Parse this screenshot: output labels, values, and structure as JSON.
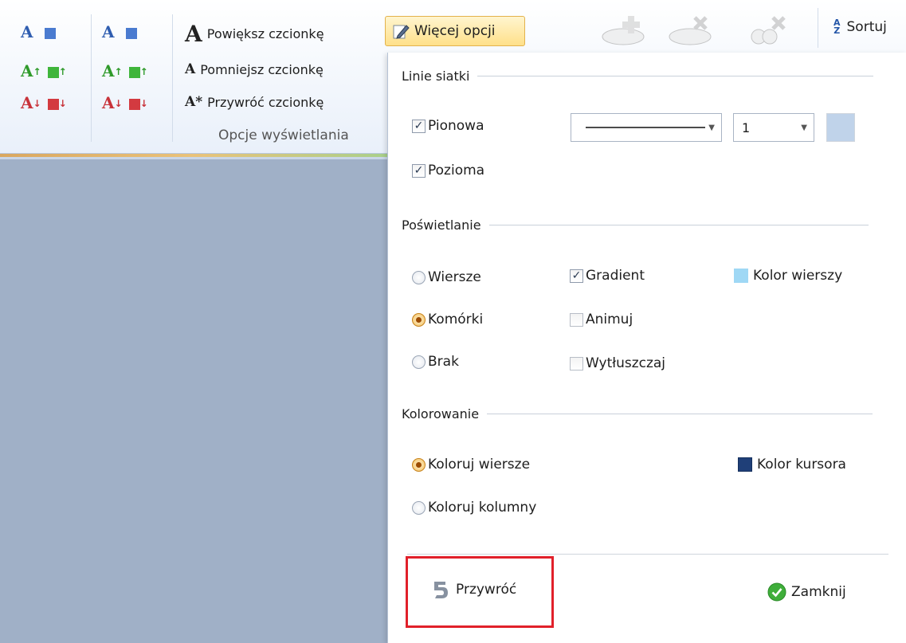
{
  "ribbon": {
    "font_glyph": "A",
    "arrow_up": "↑",
    "arrow_down": "↓",
    "commands": {
      "enlarge": "Powiększ czcionkę",
      "shrink": "Pomniejsz czcionkę",
      "restore": "Przywróć czcionkę",
      "restore_glyph": "A*"
    },
    "group_label": "Opcje wyświetlania",
    "more_options": "Więcej opcji",
    "sort": "Sortuj",
    "sort_glyph_top": "A",
    "sort_glyph_bottom": "Z"
  },
  "popup": {
    "grid_lines": {
      "title": "Linie siatki",
      "vertical": {
        "label": "Pionowa",
        "checked": true
      },
      "horizontal": {
        "label": "Pozioma",
        "checked": true
      },
      "line_width": "1"
    },
    "highlight": {
      "title": "Poświetlanie",
      "radios": [
        {
          "label": "Wiersze",
          "selected": false
        },
        {
          "label": "Komórki",
          "selected": true
        },
        {
          "label": "Brak",
          "selected": false
        }
      ],
      "checks": [
        {
          "label": "Gradient",
          "checked": true
        },
        {
          "label": "Animuj",
          "checked": false
        },
        {
          "label": "Wytłuszczaj",
          "checked": false
        }
      ],
      "row_color": {
        "label": "Kolor wierszy",
        "color": "#9fd8f5"
      }
    },
    "coloring": {
      "title": "Kolorowanie",
      "radios": [
        {
          "label": "Koloruj wiersze",
          "selected": true
        },
        {
          "label": "Koloruj kolumny",
          "selected": false
        }
      ],
      "cursor_color": {
        "label": "Kolor kursora",
        "color": "#1f3f78"
      }
    },
    "footer": {
      "restore": "Przywróć",
      "close": "Zamknij"
    }
  },
  "colors": {
    "accent_red": "#e1202a",
    "background": "#a0b0c7"
  },
  "check_mark": "✓",
  "dropdown_arrow": "▼"
}
